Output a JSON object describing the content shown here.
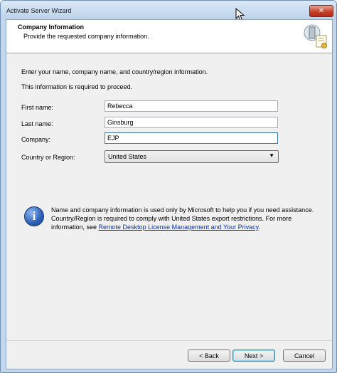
{
  "window": {
    "title": "Activate Server Wizard",
    "close_glyph": "✕"
  },
  "header": {
    "title": "Company Information",
    "subtitle": "Provide the requested company information.",
    "icon": "server-certificate-icon"
  },
  "instructions": {
    "line1": "Enter your name, company name, and country/region information.",
    "line2": "This information is required to proceed."
  },
  "form": {
    "first_name_label": "First name:",
    "first_name_value": "Rebecca",
    "last_name_label": "Last name:",
    "last_name_value": "Ginsburg",
    "company_label": "Company:",
    "company_value": "EJP",
    "country_label": "Country or Region:",
    "country_value": "United States"
  },
  "info": {
    "icon": "info-icon",
    "text": "Name and company information is used only by Microsoft to help you if you need assistance. Country/Region is required to comply with United States export restrictions. For more information, see ",
    "link_text": "Remote Desktop License Management and Your Privacy",
    "trailing": "."
  },
  "buttons": {
    "back": "< Back",
    "next": "Next >",
    "cancel": "Cancel"
  }
}
